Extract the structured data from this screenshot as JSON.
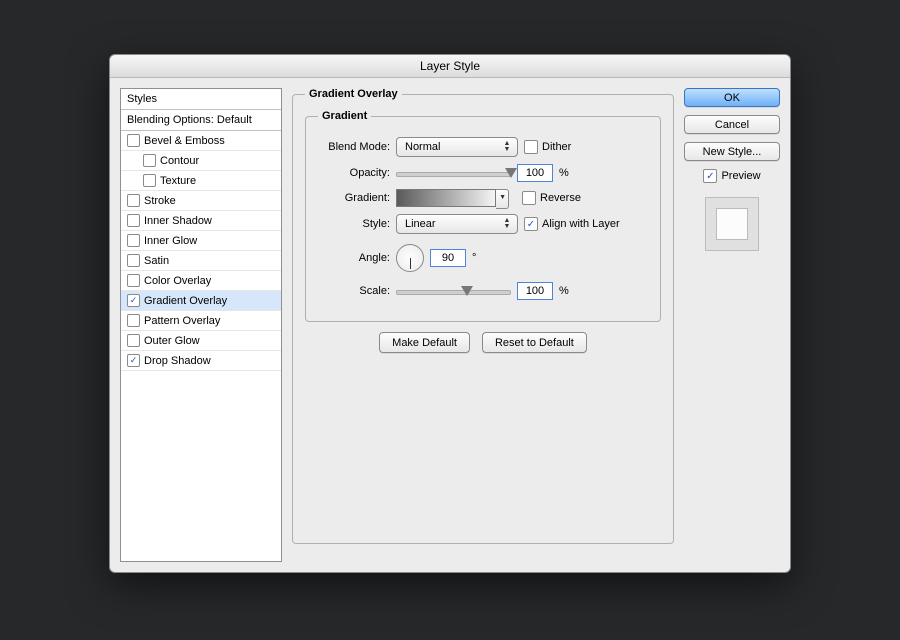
{
  "window": {
    "title": "Layer Style"
  },
  "sidebar": {
    "header": "Styles",
    "blending": "Blending Options: Default",
    "items": [
      {
        "label": "Bevel & Emboss",
        "checked": false,
        "indent": 0
      },
      {
        "label": "Contour",
        "checked": false,
        "indent": 1
      },
      {
        "label": "Texture",
        "checked": false,
        "indent": 1
      },
      {
        "label": "Stroke",
        "checked": false,
        "indent": 0
      },
      {
        "label": "Inner Shadow",
        "checked": false,
        "indent": 0
      },
      {
        "label": "Inner Glow",
        "checked": false,
        "indent": 0
      },
      {
        "label": "Satin",
        "checked": false,
        "indent": 0
      },
      {
        "label": "Color Overlay",
        "checked": false,
        "indent": 0
      },
      {
        "label": "Gradient Overlay",
        "checked": true,
        "indent": 0,
        "selected": true
      },
      {
        "label": "Pattern Overlay",
        "checked": false,
        "indent": 0
      },
      {
        "label": "Outer Glow",
        "checked": false,
        "indent": 0
      },
      {
        "label": "Drop Shadow",
        "checked": true,
        "indent": 0
      }
    ]
  },
  "panel": {
    "title": "Gradient Overlay",
    "subgroup": "Gradient",
    "labels": {
      "blend_mode": "Blend Mode:",
      "opacity": "Opacity:",
      "gradient": "Gradient:",
      "style": "Style:",
      "angle": "Angle:",
      "scale": "Scale:"
    },
    "blend_mode_value": "Normal",
    "dither": {
      "label": "Dither",
      "checked": false
    },
    "opacity": {
      "value": "100",
      "unit": "%"
    },
    "reverse": {
      "label": "Reverse",
      "checked": false
    },
    "style_value": "Linear",
    "align": {
      "label": "Align with Layer",
      "checked": true
    },
    "angle": {
      "value": "90",
      "unit": "°"
    },
    "scale": {
      "value": "100",
      "unit": "%"
    },
    "buttons": {
      "make_default": "Make Default",
      "reset_default": "Reset to Default"
    }
  },
  "right": {
    "ok": "OK",
    "cancel": "Cancel",
    "new_style": "New Style...",
    "preview": {
      "label": "Preview",
      "checked": true
    }
  }
}
